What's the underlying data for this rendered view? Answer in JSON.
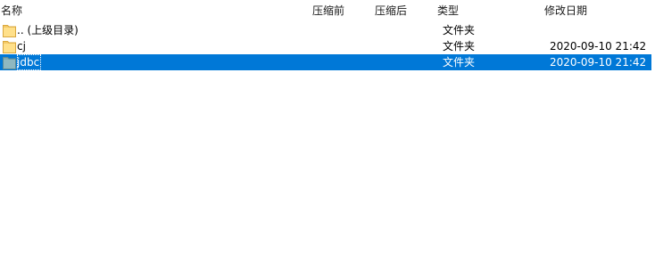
{
  "columns": {
    "name": "名称",
    "compressed": "压缩前",
    "after": "压缩后",
    "type": "类型",
    "modified": "修改日期"
  },
  "rows": [
    {
      "name": ".. (上级目录)",
      "type": "文件夹",
      "modified": "",
      "icon": "folder-icon",
      "selected": false
    },
    {
      "name": "cj",
      "type": "文件夹",
      "modified": "2020-09-10 21:42",
      "icon": "folder-icon",
      "selected": false
    },
    {
      "name": "jdbc",
      "type": "文件夹",
      "modified": "2020-09-10 21:42",
      "icon": "folder-icon",
      "selected": true
    }
  ],
  "colors": {
    "selection": "#0078d7",
    "folder": "#f4c967"
  }
}
